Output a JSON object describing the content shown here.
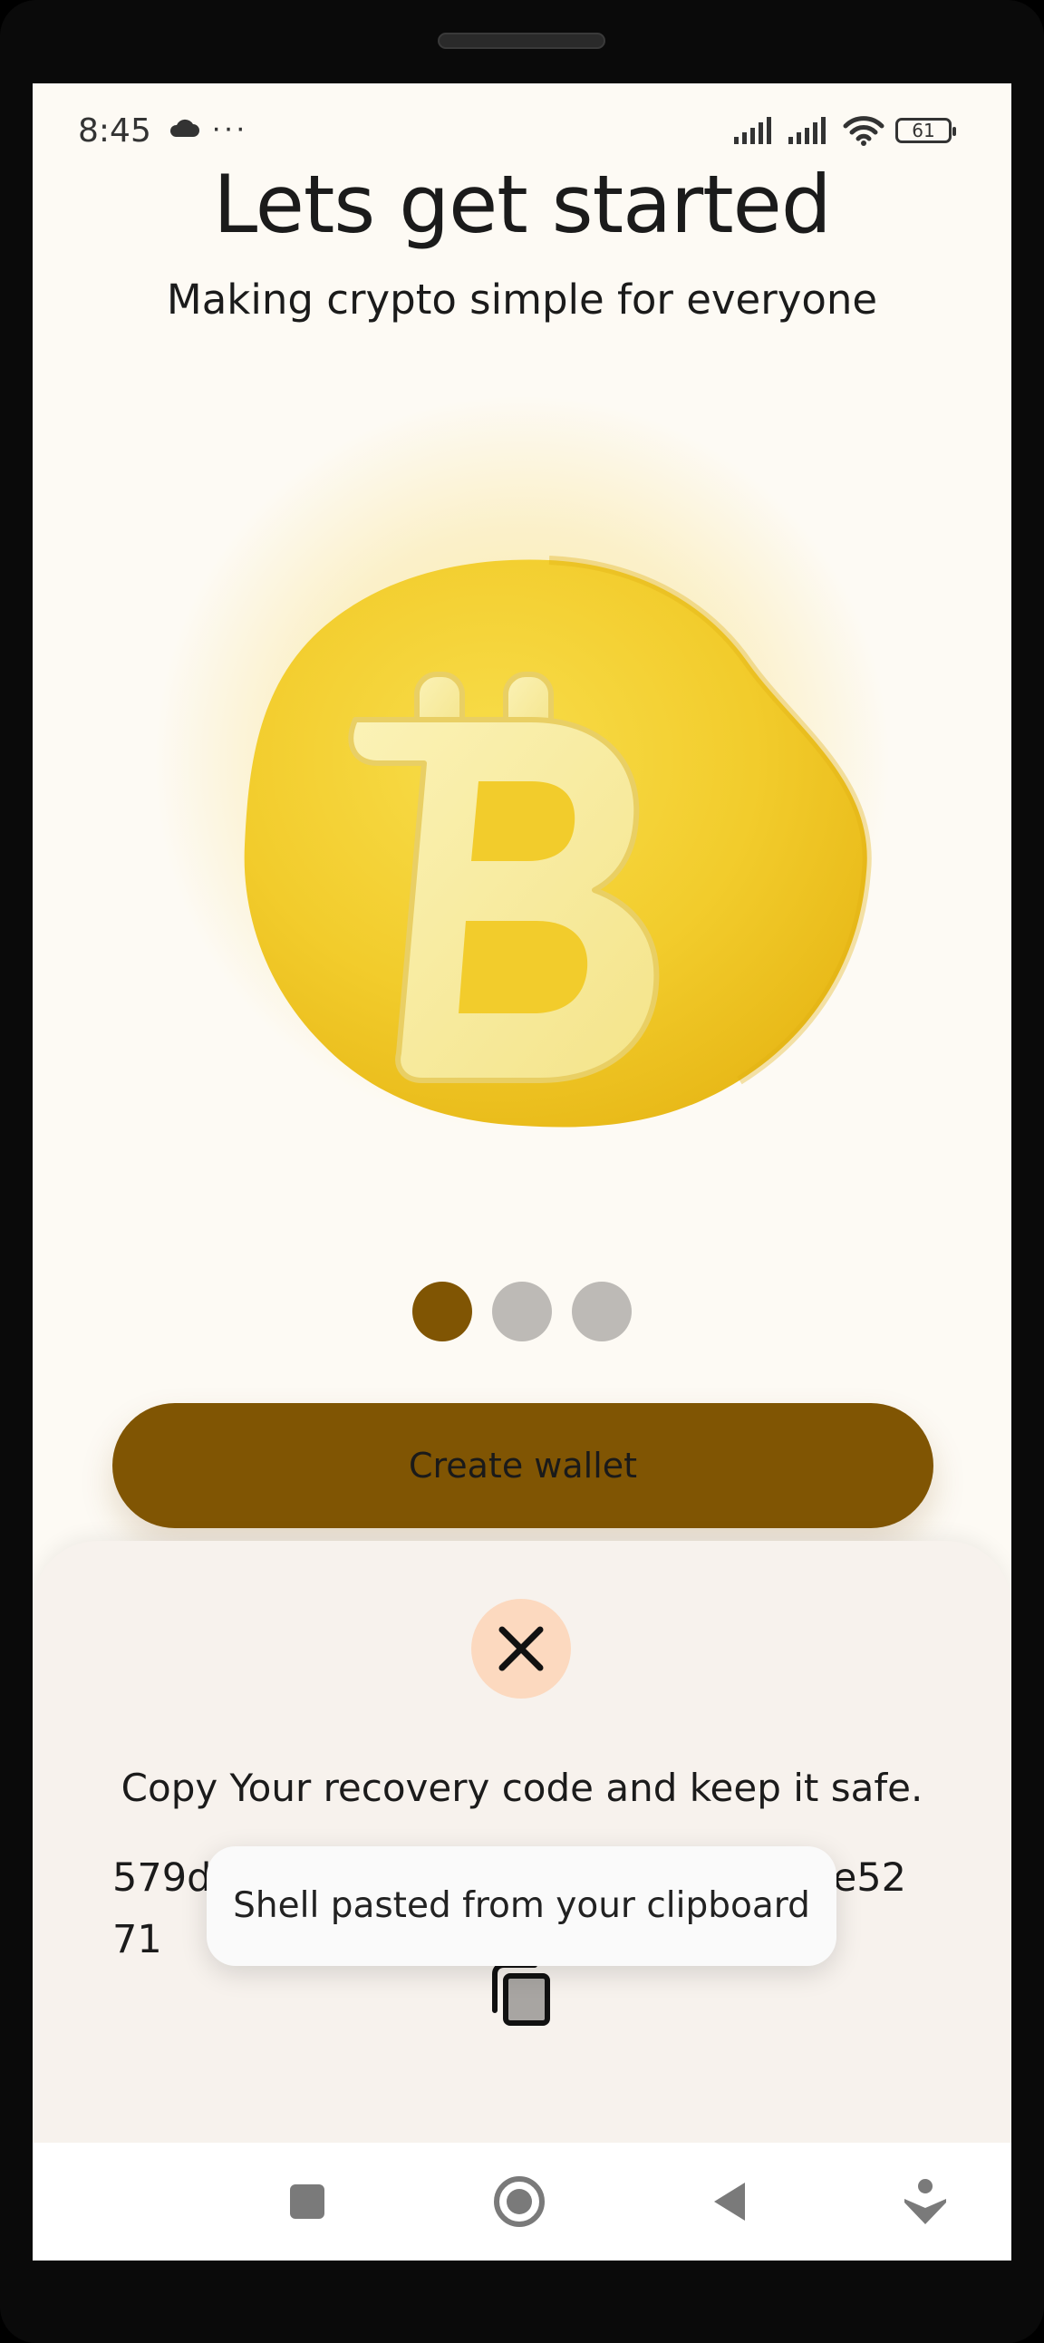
{
  "status_bar": {
    "time": "8:45",
    "more": "···",
    "battery": "61"
  },
  "onboarding": {
    "title": "Lets get started",
    "subtitle": "Making crypto simple for everyone",
    "illustration_icon": "bitcoin-coin-icon",
    "page_indicator": {
      "count": 3,
      "active_index": 0
    },
    "create_button_label": "Create wallet"
  },
  "recovery_sheet": {
    "close_icon": "close-icon",
    "message": "Copy Your recovery code and keep it safe.",
    "code_start": "579d",
    "code_end_line1": "e52",
    "code_line2": "71",
    "copy_icon": "copy-icon"
  },
  "toast": {
    "message": "Shell pasted from your clipboard"
  },
  "nav_bar": {
    "icons": [
      "recents-icon",
      "home-icon",
      "back-icon",
      "assistant-icon"
    ]
  },
  "colors": {
    "accent": "#805503",
    "screen_background": "#fdfaf4",
    "sheet_background": "#f7f2ed",
    "close_button_background": "#fcd9bf",
    "coin": "#f2cf33",
    "inactive_dot": "#bdbab6"
  }
}
